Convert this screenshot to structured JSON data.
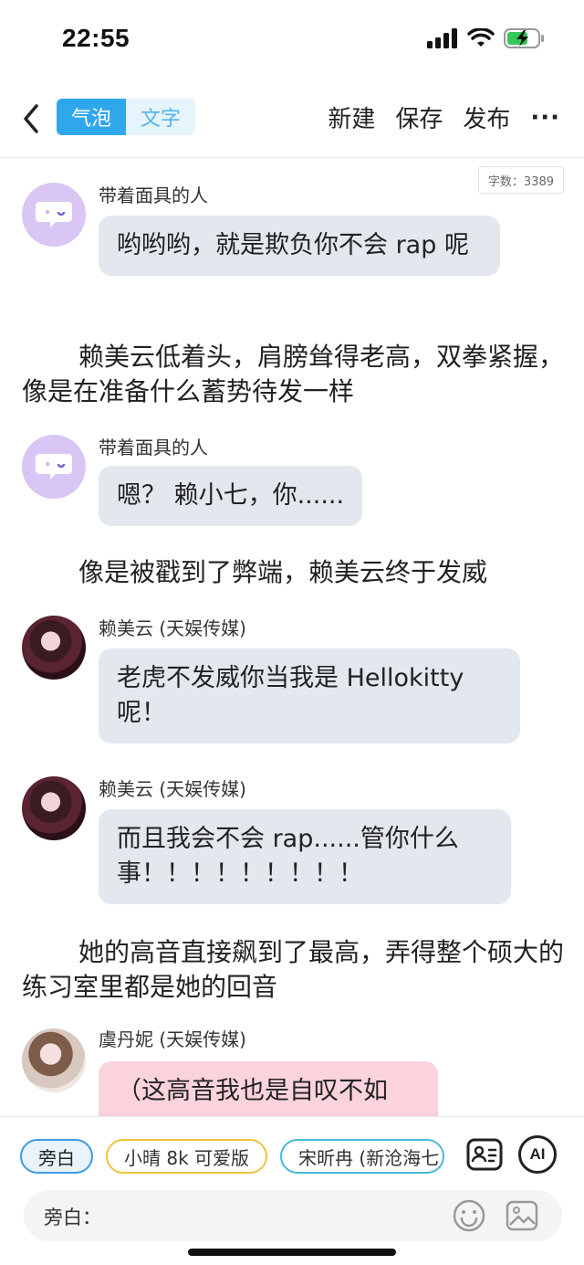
{
  "status_bar": {
    "time": "22:55"
  },
  "nav": {
    "tab_bubble": "气泡",
    "tab_text": "文字",
    "new_label": "新建",
    "save_label": "保存",
    "publish_label": "发布",
    "more_label": "···"
  },
  "word_count": "字数：3389",
  "messages": [
    {
      "name": "带着面具的人",
      "text": "哟哟哟，就是欺负你不会 rap 呢"
    },
    {
      "narration": "赖美云低着头，肩膀耸得老高，双拳紧握，像是在准备什么蓄势待发一样"
    },
    {
      "name": "带着面具的人",
      "text": "嗯？ 赖小七，你......"
    },
    {
      "narration": "像是被戳到了弊端，赖美云终于发威"
    },
    {
      "name": "赖美云 (天娱传媒)",
      "text": "老虎不发威你当我是 Hellokitty 呢！"
    },
    {
      "name": "赖美云 (天娱传媒)",
      "text": "而且我会不会 rap......管你什么事！！！！！！！！！"
    },
    {
      "narration": "她的高音直接飙到了最高，弄得整个硕大的练习室里都是她的回音"
    },
    {
      "name": "虞丹妮 (天娱传媒)",
      "text": "（这高音我也是自叹不如"
    }
  ],
  "bottom": {
    "chips": [
      "旁白",
      "小晴 8k 可爱版",
      "宋昕冉 (新沧海七"
    ],
    "ai_label": "AI",
    "input_label": "旁白："
  }
}
